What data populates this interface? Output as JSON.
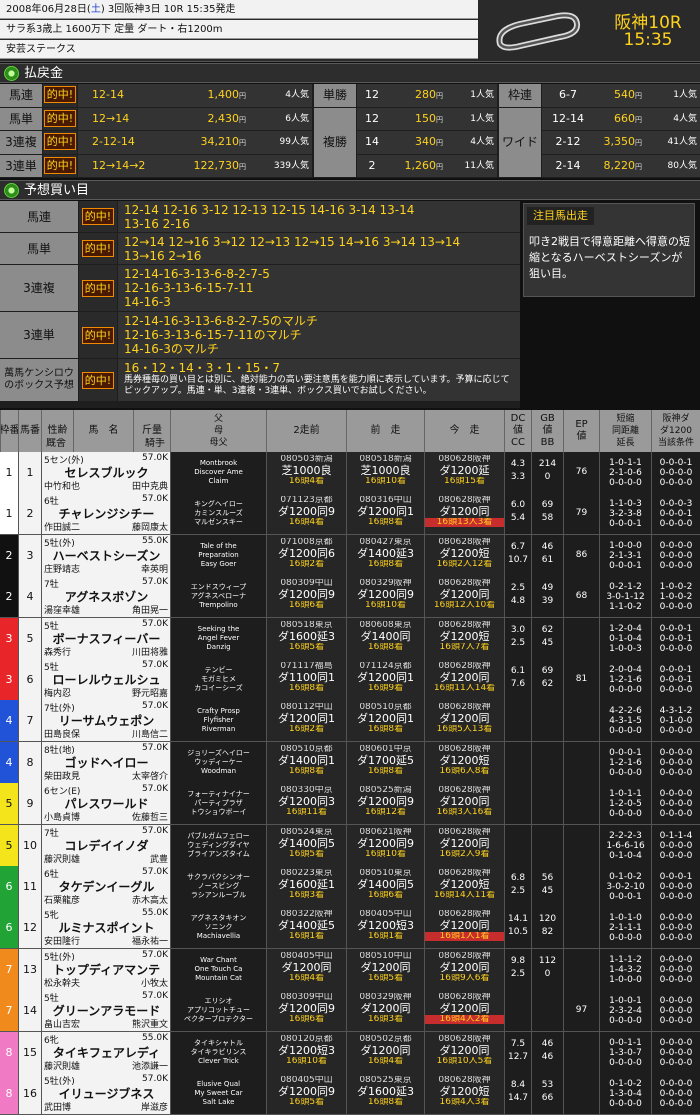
{
  "header": {
    "date_line_pre": "2008年06月28日(",
    "date_line_sat": "土",
    "date_line_post": ") 3回阪神3日 10R 15:35発走",
    "cond_line": "サラ系3歳上 1600万下  定量 ダート・右1200m",
    "race_name": "安芸ステークス",
    "venue_race": "阪神10R",
    "time": "15:35"
  },
  "payout": {
    "title": "払戻金",
    "hit_label": "的中!",
    "left": [
      {
        "label": "馬連",
        "combo": "12-14",
        "pay": "1,400",
        "pop": "4人気"
      },
      {
        "label": "馬単",
        "combo": "12→14",
        "pay": "2,430",
        "pop": "6人気"
      },
      {
        "label": "3連複",
        "combo": "2-12-14",
        "pay": "34,210",
        "pop": "99人気"
      },
      {
        "label": "3連単",
        "combo": "12→14→2",
        "pay": "122,730",
        "pop": "339人気"
      }
    ],
    "yen": "円",
    "tansho_label": "単勝",
    "tansho": {
      "no": "12",
      "pay": "280",
      "pop": "1人気"
    },
    "fukusho_label": "複勝",
    "fukusho": [
      {
        "no": "12",
        "pay": "150",
        "pop": "1人気"
      },
      {
        "no": "14",
        "pay": "340",
        "pop": "4人気"
      },
      {
        "no": "2",
        "pay": "1,260",
        "pop": "11人気"
      }
    ],
    "waku_label": "枠連",
    "waku": {
      "no": "6-7",
      "pay": "540",
      "pop": "1人気"
    },
    "wide_label": "ワイド",
    "wide": [
      {
        "no": "12-14",
        "pay": "660",
        "pop": "4人気"
      },
      {
        "no": "2-12",
        "pay": "3,350",
        "pop": "41人気"
      },
      {
        "no": "2-14",
        "pay": "8,220",
        "pop": "80人気"
      }
    ]
  },
  "picks": {
    "title": "予想買い目",
    "rows": [
      {
        "label": "馬連",
        "lines": [
          "12-14 12-16 3-12 12-13 12-15 14-16 3-14 13-14",
          "13-16 2-16"
        ]
      },
      {
        "label": "馬単",
        "lines": [
          "12→14 12→16 3→12 12→13 12→15 14→16 3→14 13→14",
          "13→16 2→16"
        ]
      },
      {
        "label": "3連複",
        "lines": [
          "12-14-16-3-13-6-8-2-7-5",
          "12-16-3-13-6-15-7-11",
          "14-16-3"
        ]
      },
      {
        "label": "3連単",
        "lines": [
          "12-14-16-3-13-6-8-2-7-5のマルチ",
          "12-16-3-13-6-15-7-11のマルチ",
          "14-16-3のマルチ"
        ]
      },
      {
        "label": "萬馬ケンシロウのボックス予想",
        "lines": [
          "16・12・14・3・1・15・7",
          "馬券種毎の買い目とは別に、絶対能力の高い要注意馬を能力順に表示しています。予算に応じてピックアップ。馬連・単、3連複・3連単、ボックス買いでお試しください。"
        ]
      }
    ],
    "note_title": "注目馬出走",
    "note_body": "叩き2戦目で得意距離へ得意の短縮となるハーベストシーズンが狙い目。"
  },
  "table": {
    "headers": {
      "waku": "枠番",
      "uma": "馬番",
      "age_sex": "性齢",
      "weight": "斤量",
      "horse": "馬　名",
      "trainer": "厩舎",
      "jockey": "騎手",
      "pedigree": "父\n母\n母父",
      "prev2": "2走前",
      "prev1": "前　走",
      "today": "今　走",
      "dc": "DC\n値\nCC",
      "gb": "GB\n値\nBB",
      "ep": "EP\n値",
      "short": "短縮\n同距離\n延長",
      "hanshin": "阪神ダ\nダ1200\n当該条件"
    },
    "rows": [
      {
        "waku": "1",
        "uma": "1",
        "sex_age": "5セン(外)",
        "kin": "57.0K",
        "name": "セレスブルック",
        "trainer": "中竹和也",
        "jockey": "田中克典",
        "ped": [
          "Montbrook",
          "Discover Ame",
          "Claim"
        ],
        "p2": [
          "080503新潟",
          "芝1000良",
          "16頭4着"
        ],
        "p1": [
          "080518新潟",
          "芝1000良",
          "16頭10着"
        ],
        "today": [
          "080628阪神",
          "ダ1200延",
          "16頭15着"
        ],
        "dc": "4.3",
        "cc": "3.3",
        "gb": "214",
        "bb": "0",
        "ep": "76",
        "short": "1-0-1-1",
        "same": "2-1-0-6",
        "long": "0-0-0-0",
        "h1": "0-0-0-1",
        "h2": "0-0-0-0",
        "h3": "0-0-0-0"
      },
      {
        "waku": "1",
        "uma": "2",
        "sex_age": "6牡",
        "kin": "57.0K",
        "name": "チャレンジシチー",
        "trainer": "作田誠二",
        "jockey": "藤岡康太",
        "ped": [
          "キングヘイロー",
          "カミンスルーズ",
          "マルゼンスキー"
        ],
        "p2": [
          "071123京都",
          "ダ1200同9",
          "16頭4着"
        ],
        "p1": [
          "080316中山",
          "ダ1200同1",
          "16頭8着"
        ],
        "today": [
          "080628阪神",
          "ダ1200同",
          "16頭13人3着"
        ],
        "dc": "6.0",
        "cc": "5.4",
        "gb": "69",
        "bb": "58",
        "ep": "79",
        "short": "1-1-0-3",
        "same": "3-2-3-8",
        "long": "0-0-0-1",
        "h1": "0-0-0-3",
        "h2": "0-0-0-1",
        "h3": "0-0-0-0"
      },
      {
        "waku": "2",
        "uma": "3",
        "sex_age": "5牡(外)",
        "kin": "55.0K",
        "name": "ハーベストシーズン",
        "trainer": "庄野靖志",
        "jockey": "幸英明",
        "ped": [
          "Tale of the",
          "Preparation",
          "Easy Goer"
        ],
        "p2": [
          "071008京都",
          "ダ1200同6",
          "16頭2着"
        ],
        "p1": [
          "080427東京",
          "ダ1400延3",
          "16頭8着"
        ],
        "today": [
          "080628阪神",
          "ダ1200短",
          "16頭2人12着"
        ],
        "dc": "6.7",
        "cc": "10.7",
        "gb": "46",
        "bb": "61",
        "ep": "86",
        "short": "1-0-0-0",
        "same": "2-1-3-1",
        "long": "0-0-0-1",
        "h1": "0-0-0-0",
        "h2": "0-0-0-0",
        "h3": "0-0-0-0"
      },
      {
        "waku": "2",
        "uma": "4",
        "sex_age": "7牡",
        "kin": "57.0K",
        "name": "アグネスボゾン",
        "trainer": "湯窪幸雄",
        "jockey": "角田晃一",
        "ped": [
          "エンドスウィープ",
          "アグネスベローナ",
          "Trempolino"
        ],
        "p2": [
          "080309中山",
          "ダ1200同9",
          "16頭6着"
        ],
        "p1": [
          "080329阪神",
          "ダ1200同9",
          "16頭10着"
        ],
        "today": [
          "080628阪神",
          "ダ1200同",
          "16頭12人10着"
        ],
        "dc": "2.5",
        "cc": "4.8",
        "gb": "49",
        "bb": "39",
        "ep": "68",
        "short": "0-2-1-2",
        "same": "3-0-1-12",
        "long": "1-1-0-2",
        "h1": "1-0-0-2",
        "h2": "1-0-0-2",
        "h3": "0-0-0-0"
      },
      {
        "waku": "3",
        "uma": "5",
        "sex_age": "5牡",
        "kin": "57.0K",
        "name": "ボーナスフィーバー",
        "trainer": "森秀行",
        "jockey": "川田将雅",
        "ped": [
          "Seeking the",
          "Angel Fever",
          "Danzig"
        ],
        "p2": [
          "080518東京",
          "ダ1600延3",
          "16頭5着"
        ],
        "p1": [
          "080608東京",
          "ダ1400同",
          "16頭8着"
        ],
        "today": [
          "080628阪神",
          "ダ1200短",
          "16頭7人7着"
        ],
        "dc": "3.0",
        "cc": "2.5",
        "gb": "62",
        "bb": "45",
        "ep": "",
        "short": "1-2-0-4",
        "same": "0-1-0-4",
        "long": "1-0-0-3",
        "h1": "0-0-0-1",
        "h2": "0-0-0-1",
        "h3": "0-0-0-0"
      },
      {
        "waku": "3",
        "uma": "6",
        "sex_age": "5牡",
        "kin": "57.0K",
        "name": "ローレルウェルシュ",
        "trainer": "梅内忍",
        "jockey": "野元昭嘉",
        "ped": [
          "テンビー",
          "モガミヒメ",
          "カコイーシーズ"
        ],
        "p2": [
          "071117福島",
          "ダ1100同1",
          "16頭8着"
        ],
        "p1": [
          "071124京都",
          "ダ1200同1",
          "16頭9着"
        ],
        "today": [
          "080628阪神",
          "ダ1200同",
          "16頭11人14着"
        ],
        "dc": "6.1",
        "cc": "7.6",
        "gb": "69",
        "bb": "62",
        "ep": "81",
        "short": "2-0-0-4",
        "same": "1-2-1-6",
        "long": "0-0-0-0",
        "h1": "0-0-0-1",
        "h2": "0-0-0-1",
        "h3": "0-0-0-0"
      },
      {
        "waku": "4",
        "uma": "7",
        "sex_age": "7牡(外)",
        "kin": "57.0K",
        "name": "リーサムウェポン",
        "trainer": "田島良保",
        "jockey": "川島信二",
        "ped": [
          "Crafty Prosp",
          "Flyfisher",
          "Riverman"
        ],
        "p2": [
          "080112中山",
          "ダ1200同1",
          "16頭2着"
        ],
        "p1": [
          "080510京都",
          "ダ1200同1",
          "16頭8着"
        ],
        "today": [
          "080628阪神",
          "ダ1200同",
          "16頭5人13着"
        ],
        "dc": "",
        "cc": "",
        "gb": "",
        "bb": "",
        "ep": "",
        "short": "4-2-2-6",
        "same": "4-3-1-5",
        "long": "0-0-0-0",
        "h1": "4-3-1-2",
        "h2": "0-1-0-0",
        "h3": "0-0-0-0"
      },
      {
        "waku": "4",
        "uma": "8",
        "sex_age": "8牡(地)",
        "kin": "57.0K",
        "name": "ゴッドヘイロー",
        "trainer": "柴田政見",
        "jockey": "太宰啓介",
        "ped": [
          "ジョリーズヘイロー",
          "ウッディーケー",
          "Woodman"
        ],
        "p2": [
          "080510京都",
          "ダ1400同1",
          "16頭8着"
        ],
        "p1": [
          "080601中京",
          "ダ1700延5",
          "16頭8着"
        ],
        "today": [
          "080628阪神",
          "ダ1200短",
          "16頭6人8着"
        ],
        "dc": "",
        "cc": "",
        "gb": "",
        "bb": "",
        "ep": "",
        "short": "0-0-0-1",
        "same": "1-2-1-6",
        "long": "0-0-0-0",
        "h1": "0-0-0-0",
        "h2": "0-0-0-0",
        "h3": "0-0-0-0"
      },
      {
        "waku": "5",
        "uma": "9",
        "sex_age": "6セン(E)",
        "kin": "57.0K",
        "name": "パレスワールド",
        "trainer": "小島貞博",
        "jockey": "佐藤哲三",
        "ped": [
          "フォーティナイナー",
          "パーティプラザ",
          "トウショウボーイ"
        ],
        "p2": [
          "080330中京",
          "ダ1200同3",
          "16頭11着"
        ],
        "p1": [
          "080525新潟",
          "ダ1200同9",
          "16頭12着"
        ],
        "today": [
          "080628阪神",
          "ダ1200同",
          "16頭3人16着"
        ],
        "dc": "",
        "cc": "",
        "gb": "",
        "bb": "",
        "ep": "",
        "short": "1-0-1-1",
        "same": "1-2-0-5",
        "long": "0-0-0-0",
        "h1": "0-0-0-0",
        "h2": "0-0-0-0",
        "h3": "0-0-0-0"
      },
      {
        "waku": "5",
        "uma": "10",
        "sex_age": "7牡",
        "kin": "57.0K",
        "name": "コレデイイノダ",
        "trainer": "藤沢則雄",
        "jockey": "武豊",
        "ped": [
          "パブルガムフェロー",
          "ウェディングダイヤ",
          "ブライアンズタイム"
        ],
        "p2": [
          "080524東京",
          "ダ1400同5",
          "16頭5着"
        ],
        "p1": [
          "080621阪神",
          "ダ1200同9",
          "16頭10着"
        ],
        "today": [
          "080628阪神",
          "ダ1200同",
          "16頭2人9着"
        ],
        "dc": "",
        "cc": "",
        "gb": "",
        "bb": "",
        "ep": "",
        "short": "2-2-2-3",
        "same": "1-6-6-16",
        "long": "0-1-0-4",
        "h1": "0-1-1-4",
        "h2": "0-0-0-0",
        "h3": "0-0-0-0"
      },
      {
        "waku": "6",
        "uma": "11",
        "sex_age": "6牡",
        "kin": "57.0K",
        "name": "タケデンイーグル",
        "trainer": "石栗龍彦",
        "jockey": "赤木高太",
        "ped": [
          "サクラバクシンオー",
          "ノースビング",
          "ラシアンルーブル"
        ],
        "p2": [
          "080223東京",
          "ダ1600延1",
          "16頭3着"
        ],
        "p1": [
          "080510東京",
          "ダ1400同5",
          "16頭6着"
        ],
        "today": [
          "080628阪神",
          "ダ1200短",
          "16頭14人11着"
        ],
        "dc": "6.8",
        "cc": "2.5",
        "gb": "56",
        "bb": "45",
        "ep": "",
        "short": "0-1-0-2",
        "same": "3-0-2-10",
        "long": "0-0-0-1",
        "h1": "0-0-0-1",
        "h2": "0-0-0-0",
        "h3": "0-0-0-0"
      },
      {
        "waku": "6",
        "uma": "12",
        "sex_age": "5牝",
        "kin": "55.0K",
        "name": "ルミナスポイント",
        "trainer": "安田隆行",
        "jockey": "福永祐一",
        "ped": [
          "アグネスタキオン",
          "ソニンク",
          "Machiavellia"
        ],
        "p2": [
          "080322阪神",
          "ダ1400延5",
          "16頭1着"
        ],
        "p1": [
          "080405中山",
          "ダ1200短3",
          "16頭1着"
        ],
        "today": [
          "080628阪神",
          "ダ1200同",
          "16頭1人1着"
        ],
        "dc": "14.1",
        "cc": "10.5",
        "gb": "120",
        "bb": "82",
        "ep": "",
        "short": "1-0-1-0",
        "same": "2-1-1-1",
        "long": "0-0-0-0",
        "h1": "0-0-0-0",
        "h2": "0-0-0-0",
        "h3": "0-0-0-0"
      },
      {
        "waku": "7",
        "uma": "13",
        "sex_age": "5牡(外)",
        "kin": "57.0K",
        "name": "トップディアマンテ",
        "trainer": "松永幹夫",
        "jockey": "小牧太",
        "ped": [
          "War Chant",
          "One Touch Ca",
          "Mountain Cat"
        ],
        "p2": [
          "080405中山",
          "ダ1200同",
          "16頭4着"
        ],
        "p1": [
          "080510中山",
          "ダ1200同",
          "16頭5着"
        ],
        "today": [
          "080628阪神",
          "ダ1200同",
          "16頭9人6着"
        ],
        "dc": "9.8",
        "cc": "2.5",
        "gb": "112",
        "bb": "0",
        "ep": "",
        "short": "1-1-1-2",
        "same": "1-4-3-2",
        "long": "1-0-0-0",
        "h1": "0-0-0-0",
        "h2": "0-0-0-0",
        "h3": "0-0-0-0"
      },
      {
        "waku": "7",
        "uma": "14",
        "sex_age": "5牡",
        "kin": "57.0K",
        "name": "グリーンアラモード",
        "trainer": "畠山吉宏",
        "jockey": "熊沢重文",
        "ped": [
          "エリシオ",
          "アプリコットチュー",
          "ペクターブロテクター"
        ],
        "p2": [
          "080309中山",
          "ダ1200同9",
          "16頭6着"
        ],
        "p1": [
          "080329阪神",
          "ダ1200同",
          "16頭3着"
        ],
        "today": [
          "080628阪神",
          "ダ1200同",
          "16頭4人2着"
        ],
        "dc": "",
        "cc": "",
        "gb": "",
        "bb": "",
        "ep": "97",
        "short": "1-0-0-1",
        "same": "2-3-2-4",
        "long": "0-0-0-0",
        "h1": "0-0-0-0",
        "h2": "0-0-0-0",
        "h3": "0-0-0-0"
      },
      {
        "waku": "8",
        "uma": "15",
        "sex_age": "6牝",
        "kin": "55.0K",
        "name": "タイキフェアレディ",
        "trainer": "藤沢則雄",
        "jockey": "池添謙一",
        "ped": [
          "タイキシャトル",
          "タイキラビリンス",
          "Clever Trick"
        ],
        "p2": [
          "080120京都",
          "ダ1200短3",
          "16頭10着"
        ],
        "p1": [
          "080502京都",
          "ダ1200同",
          "16頭4着"
        ],
        "today": [
          "080628阪神",
          "ダ1200同",
          "16頭10人5着"
        ],
        "dc": "7.5",
        "cc": "12.7",
        "gb": "46",
        "bb": "46",
        "ep": "",
        "short": "0-0-1-1",
        "same": "1-3-0-7",
        "long": "0-0-0-0",
        "h1": "0-0-0-0",
        "h2": "0-0-0-0",
        "h3": "0-0-0-0"
      },
      {
        "waku": "8",
        "uma": "16",
        "sex_age": "5牡(外)",
        "kin": "57.0K",
        "name": "イリュージブネス",
        "trainer": "武田博",
        "jockey": "岸滋彦",
        "ped": [
          "Elusive Qual",
          "My Sweet Car",
          "Salt Lake"
        ],
        "p2": [
          "080405中山",
          "ダ1200同9",
          "16頭5着"
        ],
        "p1": [
          "080525東京",
          "ダ1600延3",
          "16頭8着"
        ],
        "today": [
          "080628阪神",
          "ダ1200短",
          "16頭4人3着"
        ],
        "dc": "8.4",
        "cc": "14.7",
        "gb": "53",
        "bb": "66",
        "ep": "",
        "short": "0-1-0-2",
        "same": "1-3-0-4",
        "long": "0-0-0-0",
        "h1": "0-0-0-0",
        "h2": "0-0-0-0",
        "h3": "0-0-0-0"
      }
    ]
  },
  "colors": {
    "accent": "#ffd21e",
    "hit_border": "#f08a00",
    "waku": [
      "#ffffff",
      "#111111",
      "#e8262a",
      "#2053d8",
      "#f3e41c",
      "#21a335",
      "#f08a1c",
      "#f07ac3"
    ]
  }
}
